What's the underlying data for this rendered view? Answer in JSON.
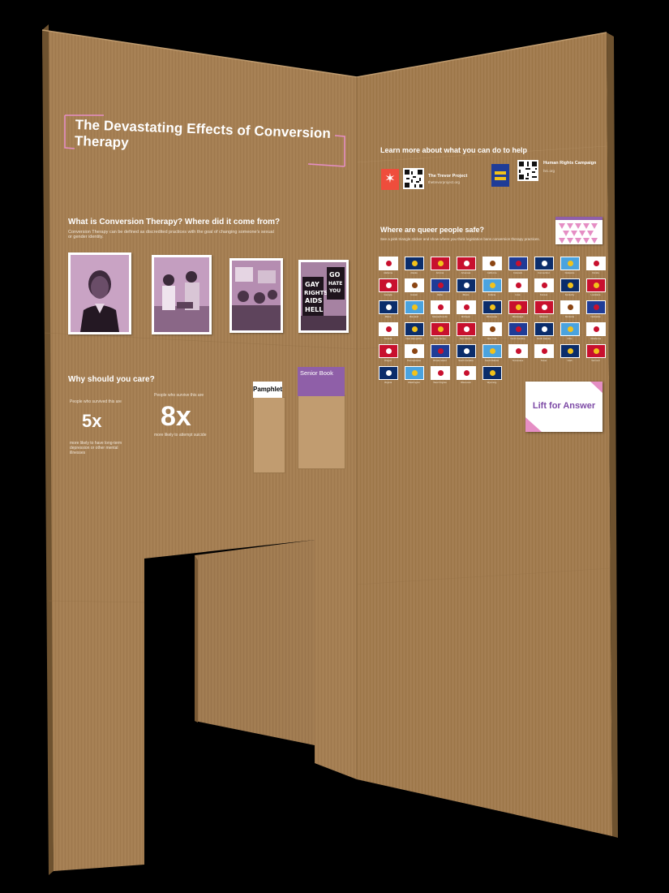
{
  "title": "The Devastating Effects of Conversion Therapy",
  "what_is": {
    "heading": "What is Conversion Therapy? Where did it come from?",
    "body": "Conversion Therapy can be defined as discredited practices with the goal of changing someone's sexual or gender identity."
  },
  "photos": [
    "portrait-photo",
    "clinic-photo",
    "protest-photo",
    "gay-rights-aids-hell-photo"
  ],
  "why_care": {
    "heading": "Why should you care?",
    "stats": [
      {
        "intro": "People who survived this are",
        "value": "5x",
        "outro": "more likely to have long-term depression or other mental illnesses"
      },
      {
        "intro": "People who survive this are",
        "value": "8x",
        "outro": "more likely to attempt suicide"
      }
    ]
  },
  "pamphlet_label": "Pamphlet",
  "senior_book_label": "Senior Book",
  "learn_more": {
    "heading": "Learn more about what you can do to help",
    "orgs": [
      {
        "name": "The Trevor Project",
        "url": "thetrevorproject.org"
      },
      {
        "name": "Human Rights Campaign",
        "url": "hrc.org"
      }
    ]
  },
  "where_safe": {
    "heading": "Where are queer people safe?",
    "body": "See a pink triangle sticker and show where you think legislation bans conversion therapy practices."
  },
  "flags": [
    [
      "Alabama",
      "Alaska",
      "Arizona",
      "Arkansas",
      "California",
      "Colorado",
      "Connecticut",
      "Delaware",
      "Florida"
    ],
    [
      "Georgia",
      "Hawaii",
      "Idaho",
      "Illinois",
      "Indiana",
      "Iowa",
      "Kansas",
      "Kentucky",
      "Louisiana"
    ],
    [
      "Maine",
      "Maryland",
      "Massachusetts",
      "Michigan",
      "Minnesota",
      "Mississippi",
      "Missouri",
      "Montana",
      "Nebraska"
    ],
    [
      "Nevada",
      "New Hampshire",
      "New Jersey",
      "New Mexico",
      "New York",
      "North Carolina",
      "North Dakota",
      "Ohio",
      "Oklahoma"
    ],
    [
      "Oregon",
      "Pennsylvania",
      "Rhode Island",
      "South Carolina",
      "South Dakota",
      "Tennessee",
      "Texas",
      "Utah",
      "Vermont"
    ],
    [
      "Virginia",
      "Washington",
      "West Virginia",
      "Wisconsin",
      "Wyoming"
    ]
  ],
  "lift_card": "Lift for Answer",
  "colors": {
    "cardboard": "#a57f53",
    "accent_pink": "#e58ec4",
    "accent_purple": "#8f5fa8",
    "background": "#000000"
  }
}
